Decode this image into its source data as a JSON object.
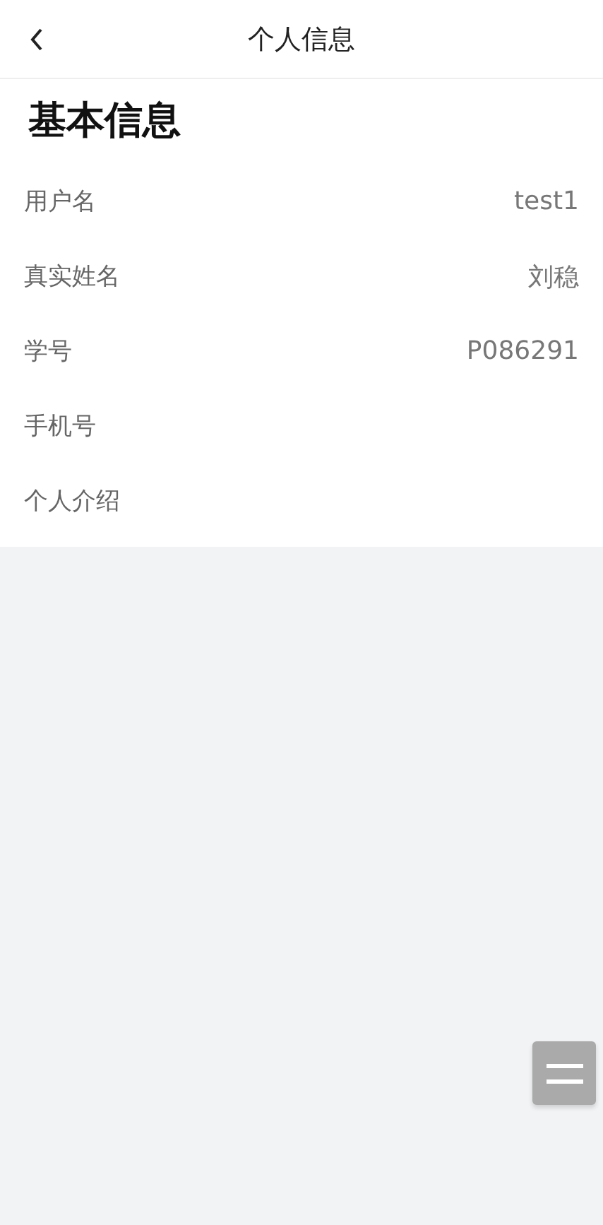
{
  "header": {
    "title": "个人信息"
  },
  "section": {
    "title": "基本信息",
    "rows": [
      {
        "label": "用户名",
        "value": "test1"
      },
      {
        "label": "真实姓名",
        "value": "刘稳"
      },
      {
        "label": "学号",
        "value": "P086291"
      },
      {
        "label": "手机号"
      },
      {
        "label": "个人介绍"
      }
    ]
  }
}
